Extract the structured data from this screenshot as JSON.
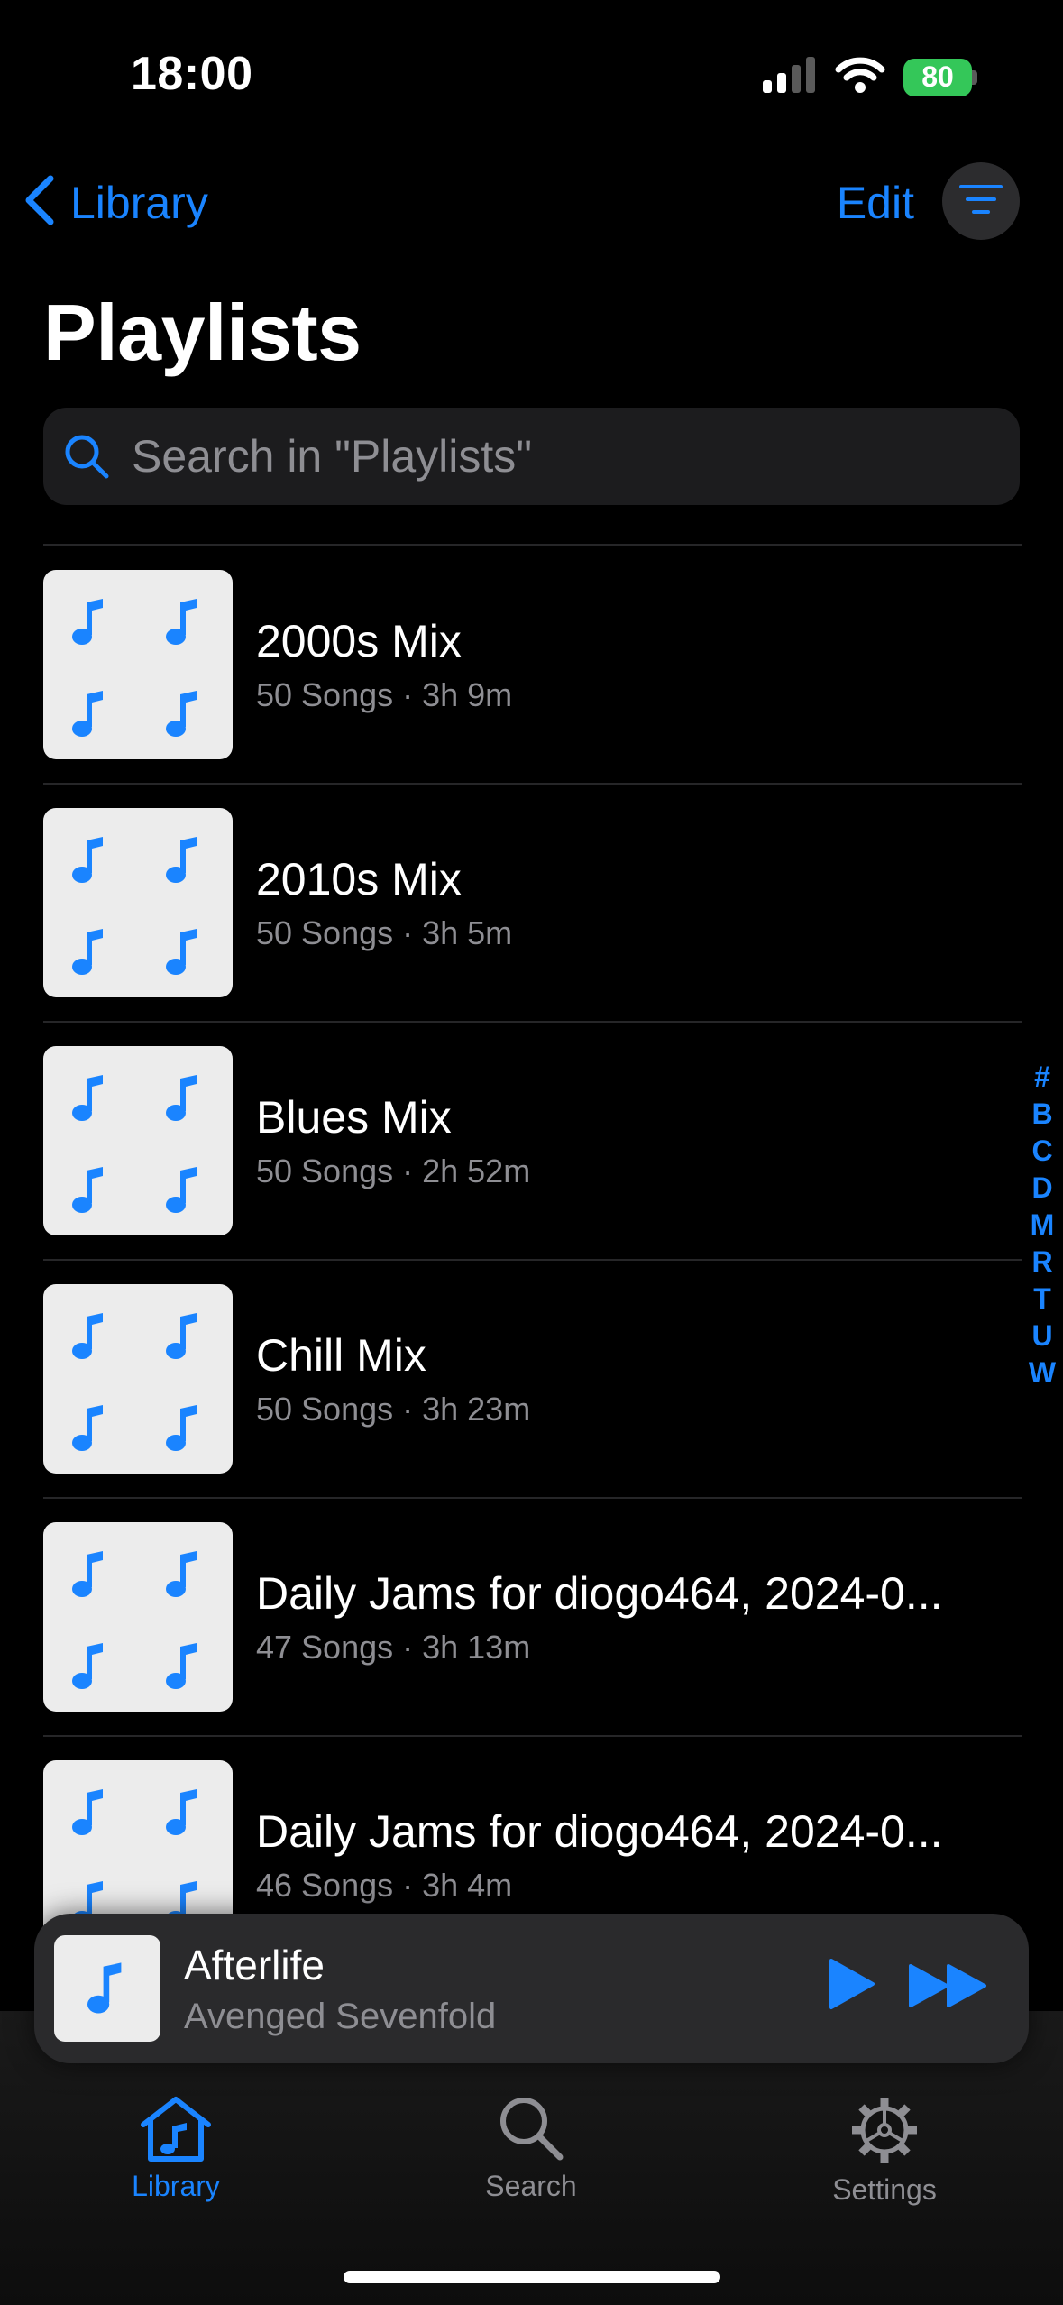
{
  "status_bar": {
    "time": "18:00",
    "battery": "80"
  },
  "nav": {
    "back_label": "Library",
    "edit_label": "Edit"
  },
  "page_title": "Playlists",
  "search": {
    "placeholder": "Search in \"Playlists\""
  },
  "playlists": [
    {
      "title": "2000s Mix",
      "subtitle": "50 Songs · 3h 9m"
    },
    {
      "title": "2010s Mix",
      "subtitle": "50 Songs · 3h 5m"
    },
    {
      "title": "Blues Mix",
      "subtitle": "50 Songs · 2h 52m"
    },
    {
      "title": "Chill Mix",
      "subtitle": "50 Songs · 3h 23m"
    },
    {
      "title": "Daily Jams for diogo464, 2024-0...",
      "subtitle": "47 Songs · 3h 13m"
    },
    {
      "title": "Daily Jams for diogo464, 2024-0...",
      "subtitle": "46 Songs · 3h 4m"
    }
  ],
  "index_letters": [
    "#",
    "B",
    "C",
    "D",
    "M",
    "R",
    "T",
    "U",
    "W"
  ],
  "now_playing": {
    "title": "Afterlife",
    "artist": "Avenged Sevenfold"
  },
  "tabs": [
    {
      "label": "Library",
      "icon": "library-icon",
      "active": true
    },
    {
      "label": "Search",
      "icon": "search-icon",
      "active": false
    },
    {
      "label": "Settings",
      "icon": "gear-icon",
      "active": false
    }
  ],
  "colors": {
    "accent": "#1a84ff",
    "background": "#000000",
    "secondary_text": "#8e8e93",
    "battery": "#34c759"
  }
}
